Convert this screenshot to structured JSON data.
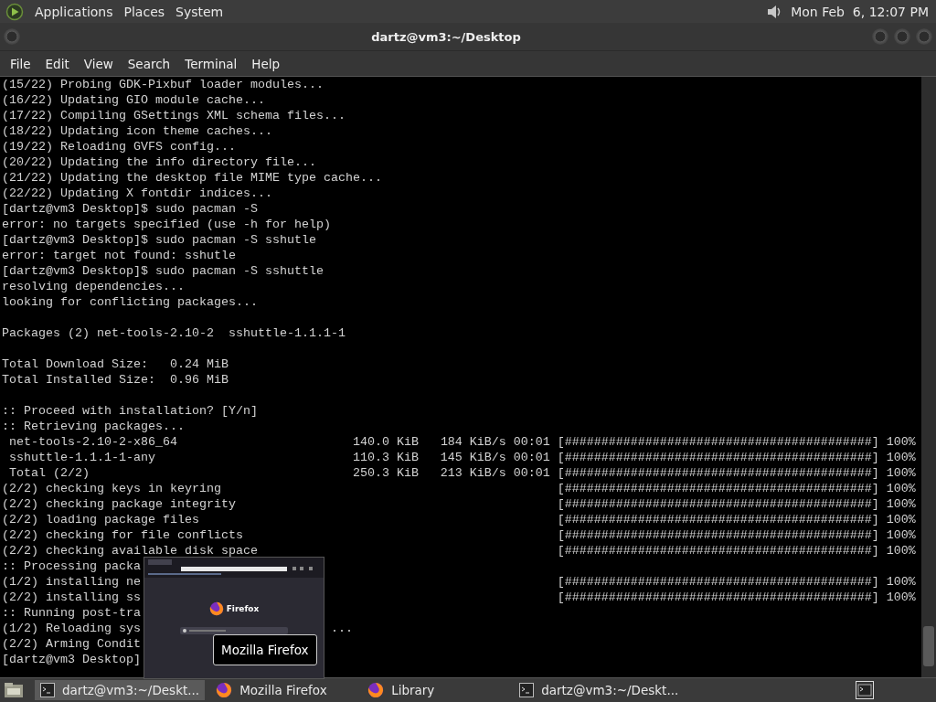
{
  "top_panel": {
    "menus": [
      "Applications",
      "Places",
      "System"
    ],
    "clock": "Mon Feb  6, 12:07 PM"
  },
  "window": {
    "title": "dartz@vm3:~/Desktop",
    "menu": [
      "File",
      "Edit",
      "View",
      "Search",
      "Terminal",
      "Help"
    ]
  },
  "terminal": {
    "lines": [
      {
        "kind": "text",
        "text": "(15/22) Probing GDK-Pixbuf loader modules..."
      },
      {
        "kind": "text",
        "text": "(16/22) Updating GIO module cache..."
      },
      {
        "kind": "text",
        "text": "(17/22) Compiling GSettings XML schema files..."
      },
      {
        "kind": "text",
        "text": "(18/22) Updating icon theme caches..."
      },
      {
        "kind": "text",
        "text": "(19/22) Reloading GVFS config..."
      },
      {
        "kind": "text",
        "text": "(20/22) Updating the info directory file..."
      },
      {
        "kind": "text",
        "text": "(21/22) Updating the desktop file MIME type cache..."
      },
      {
        "kind": "text",
        "text": "(22/22) Updating X fontdir indices..."
      },
      {
        "kind": "text",
        "text": "[dartz@vm3 Desktop]$ sudo pacman -S"
      },
      {
        "kind": "text",
        "text": "error: no targets specified (use -h for help)"
      },
      {
        "kind": "text",
        "text": "[dartz@vm3 Desktop]$ sudo pacman -S sshutle"
      },
      {
        "kind": "text",
        "text": "error: target not found: sshutle"
      },
      {
        "kind": "text",
        "text": "[dartz@vm3 Desktop]$ sudo pacman -S sshuttle"
      },
      {
        "kind": "text",
        "text": "resolving dependencies..."
      },
      {
        "kind": "text",
        "text": "looking for conflicting packages..."
      },
      {
        "kind": "blank"
      },
      {
        "kind": "text",
        "text": "Packages (2) net-tools-2.10-2  sshuttle-1.1.1-1"
      },
      {
        "kind": "blank"
      },
      {
        "kind": "text",
        "text": "Total Download Size:   0.24 MiB"
      },
      {
        "kind": "text",
        "text": "Total Installed Size:  0.96 MiB"
      },
      {
        "kind": "blank"
      },
      {
        "kind": "text",
        "text": ":: Proceed with installation? [Y/n]"
      },
      {
        "kind": "text",
        "text": ":: Retrieving packages..."
      },
      {
        "kind": "download",
        "text": "net-tools-2.10-2-x86_64",
        "size": "140.0 KiB",
        "rate": "184 KiB/s 00:01",
        "bar": "[##########################################]",
        "percent": "100%"
      },
      {
        "kind": "download",
        "text": "sshuttle-1.1.1-1-any",
        "size": "110.3 KiB",
        "rate": "145 KiB/s 00:01",
        "bar": "[##########################################]",
        "percent": "100%"
      },
      {
        "kind": "download",
        "text": "Total (2/2)",
        "size": "250.3 KiB",
        "rate": "213 KiB/s 00:01",
        "bar": "[##########################################]",
        "percent": "100%"
      },
      {
        "kind": "progress",
        "text": "(2/2) checking keys in keyring",
        "bar": "[##########################################]",
        "percent": "100%"
      },
      {
        "kind": "progress",
        "text": "(2/2) checking package integrity",
        "bar": "[##########################################]",
        "percent": "100%"
      },
      {
        "kind": "progress",
        "text": "(2/2) loading package files",
        "bar": "[##########################################]",
        "percent": "100%"
      },
      {
        "kind": "progress",
        "text": "(2/2) checking for file conflicts",
        "bar": "[##########################################]",
        "percent": "100%"
      },
      {
        "kind": "progress",
        "text": "(2/2) checking available disk space",
        "bar": "[##########################################]",
        "percent": "100%"
      },
      {
        "kind": "text",
        "text": ":: Processing packa"
      },
      {
        "kind": "progress",
        "text": "(1/2) installing ne",
        "bar": "[##########################################]",
        "percent": "100%"
      },
      {
        "kind": "progress",
        "text": "(2/2) installing ss",
        "bar": "[##########################################]",
        "percent": "100%"
      },
      {
        "kind": "text",
        "text": ":: Running post-tra"
      },
      {
        "kind": "trail",
        "text": "(1/2) Reloading sys",
        "tail": "..."
      },
      {
        "kind": "text",
        "text": "(2/2) Arming Condit"
      },
      {
        "kind": "text",
        "text": "[dartz@vm3 Desktop]"
      }
    ]
  },
  "preview": {
    "app_name": "Firefox",
    "tooltip": "Mozilla Firefox"
  },
  "taskbar": {
    "tasks": [
      {
        "kind": "terminal",
        "label": "dartz@vm3:~/Deskt...",
        "selected": true
      },
      {
        "kind": "firefox",
        "label": "Mozilla Firefox",
        "selected": false
      },
      {
        "kind": "firefox",
        "label": "Library",
        "selected": false
      },
      {
        "kind": "terminal",
        "label": "dartz@vm3:~/Deskt...",
        "selected": false
      }
    ]
  }
}
